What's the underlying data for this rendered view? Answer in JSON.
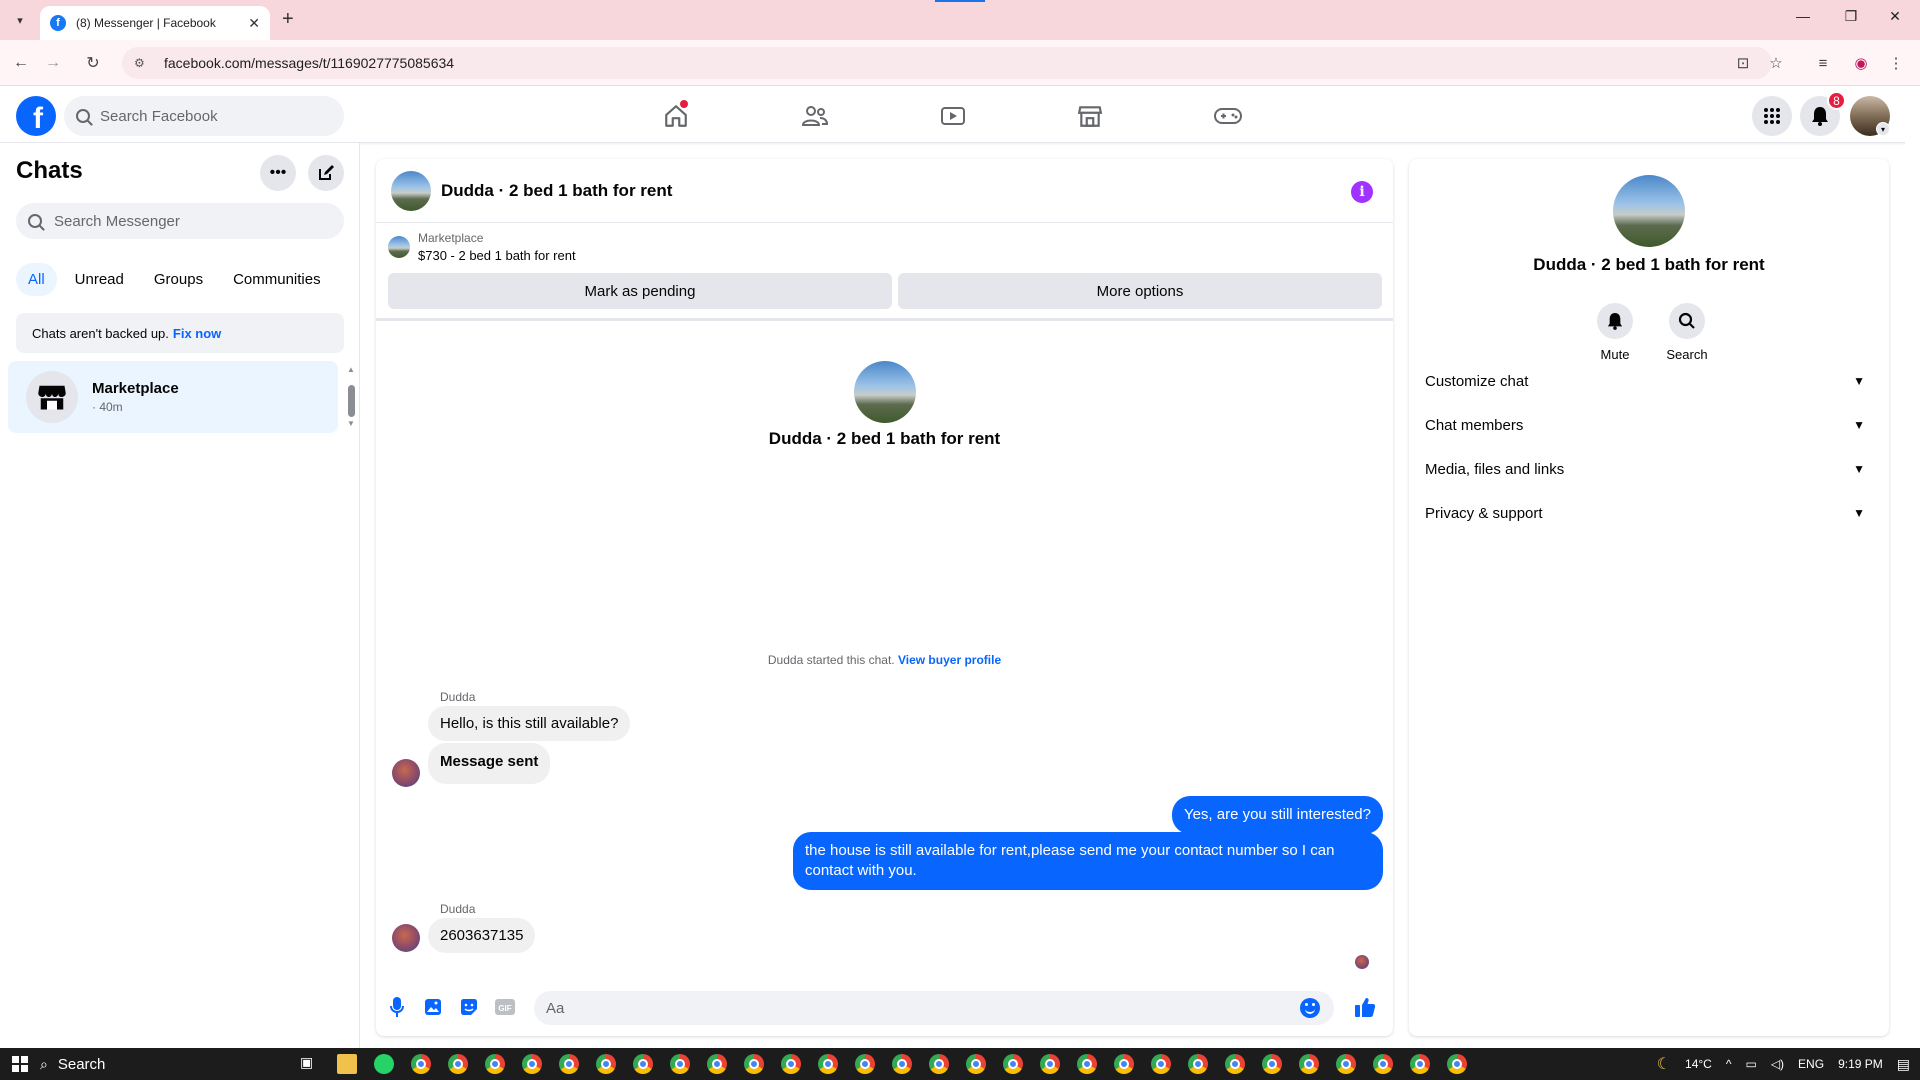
{
  "browser": {
    "tab_title": "(8) Messenger | Facebook",
    "url": "facebook.com/messages/t/1169027775085634"
  },
  "fb": {
    "search_placeholder": "Search Facebook",
    "notification_count": "8"
  },
  "left": {
    "title": "Chats",
    "search_placeholder": "Search Messenger",
    "tabs": [
      "All",
      "Unread",
      "Groups",
      "Communities"
    ],
    "active_tab": "All",
    "backup_text": "Chats aren't backed up.",
    "backup_link": "Fix now",
    "chat": {
      "name": "Marketplace",
      "time": "· 40m"
    }
  },
  "conversation": {
    "title": "Dudda · 2 bed 1 bath for rent",
    "marketplace_label": "Marketplace",
    "listing": "$730 - 2 bed 1 bath for rent",
    "mark_pending": "Mark as pending",
    "more_options": "More options",
    "intro_name": "Dudda · 2 bed 1 bath for rent",
    "started_text": "Dudda started this chat.",
    "view_profile": "View buyer profile",
    "sender": "Dudda",
    "msg1": "Hello, is this still available?",
    "msg2": "Message sent",
    "out1": "Yes, are you still interested?",
    "out2": "the house is still available for rent,please send me your contact number so I can contact with you.",
    "sender2": "Dudda",
    "msg3": "2603637135",
    "composer_placeholder": "Aa"
  },
  "right": {
    "name": "Dudda · 2 bed 1 bath for rent",
    "mute": "Mute",
    "search": "Search",
    "sections": [
      "Customize chat",
      "Chat members",
      "Media, files and links",
      "Privacy & support"
    ]
  },
  "taskbar": {
    "search": "Search",
    "weather": "14°C",
    "lang": "ENG",
    "time": "9:19 PM"
  },
  "colors": {
    "accent": "#0866ff",
    "info": "#a033ff",
    "badge": "#e41e3f"
  }
}
